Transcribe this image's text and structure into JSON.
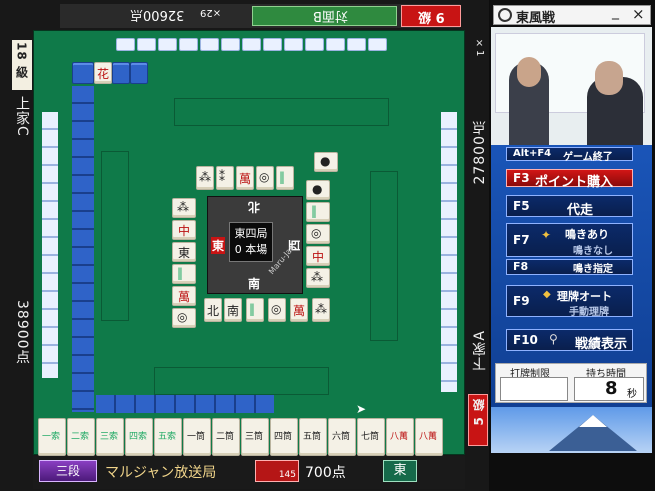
{
  "players": {
    "top": {
      "name": "対面B",
      "rank": "9 級",
      "score": "32600点",
      "multiplier": "×29"
    },
    "left": {
      "name": "上家C",
      "rank": "18 級",
      "score": "38900点"
    },
    "right": {
      "name": "下家A",
      "rank": "5 級",
      "score": "27800点",
      "multiplier": "×1"
    },
    "self": {
      "name": "マルジャン放送局",
      "dan": "三段",
      "score": "700点",
      "bonus": "145",
      "seat": "東"
    }
  },
  "center": {
    "round": "東四局",
    "honba": "0 本場",
    "winds": {
      "north": "北",
      "west": "西",
      "south": "南",
      "east": "東"
    },
    "watermark": "Maru-Jan"
  },
  "window": {
    "title": "東風戦",
    "minimize": "_",
    "close": "×"
  },
  "buttons": [
    {
      "key": "Alt+F4",
      "label": "ゲーム終了"
    },
    {
      "key": "F3",
      "label": "ポイント購入"
    },
    {
      "key": "F5",
      "label": "代走"
    },
    {
      "key": "F7",
      "label": "鳴きあり",
      "sub": "鳴きなし"
    },
    {
      "key": "F8",
      "label": "鳴き指定"
    },
    {
      "key": "F9",
      "label": "理牌オート",
      "sub": "手動理牌"
    },
    {
      "key": "F10",
      "label": "戦績表示"
    }
  ],
  "timer": {
    "discard_label": "打牌制限",
    "time_label": "持ち時間",
    "seconds": "8",
    "unit": "秒"
  },
  "colors": {
    "felt": "#0f7a49",
    "tile_back": "#2f63c8",
    "panel": "#1a55b8",
    "accent_red": "#c81414"
  },
  "hand_tiles": [
    "一索",
    "二索",
    "三索",
    "四索",
    "五索",
    "一筒",
    "二筒",
    "三筒",
    "四筒",
    "五筒",
    "六筒",
    "七筒",
    "八萬",
    "八萬"
  ]
}
